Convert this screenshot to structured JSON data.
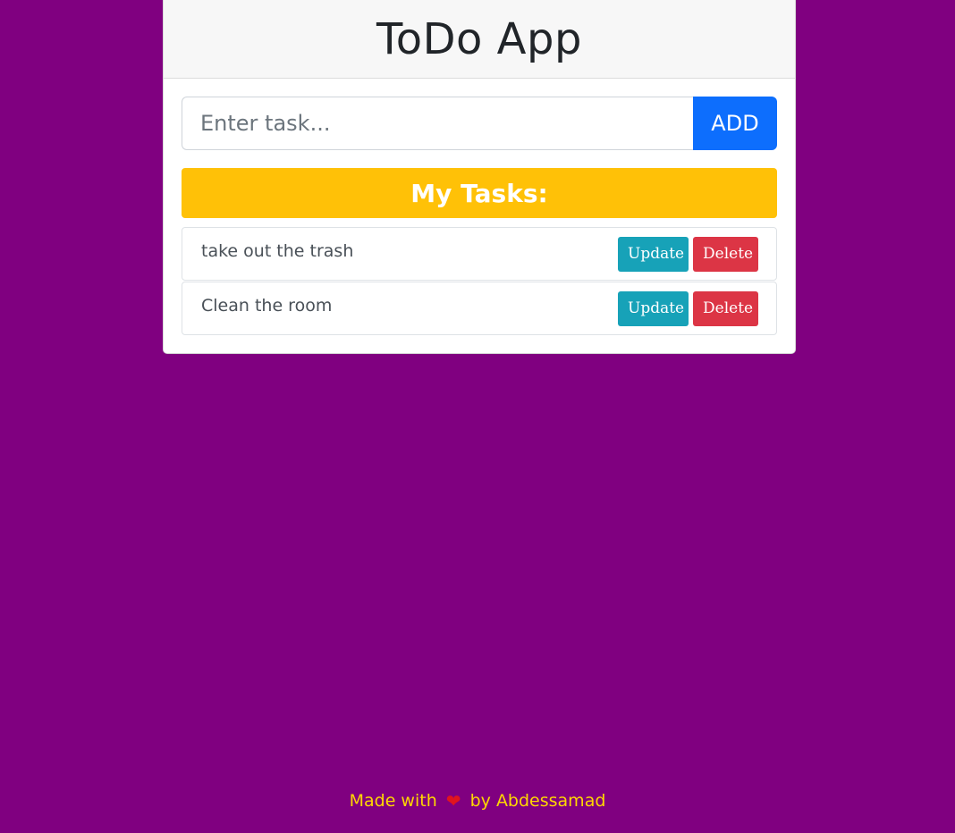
{
  "app": {
    "title": "ToDo App"
  },
  "input": {
    "placeholder": "Enter task...",
    "value": "",
    "add_label": "ADD"
  },
  "tasks_header": "My Tasks:",
  "tasks": [
    {
      "text": "take out the trash",
      "update_label": "Update",
      "delete_label": "Delete"
    },
    {
      "text": "Clean the room",
      "update_label": "Update",
      "delete_label": "Delete"
    }
  ],
  "footer": {
    "prefix": "Made with",
    "icon": "heart-icon",
    "suffix": "by Abdessamad"
  },
  "colors": {
    "background": "#800080",
    "add_button": "#0d6efd",
    "tasks_header": "#ffc107",
    "update_button": "#17a2b8",
    "delete_button": "#dc3545",
    "footer_text": "#ffd700"
  }
}
